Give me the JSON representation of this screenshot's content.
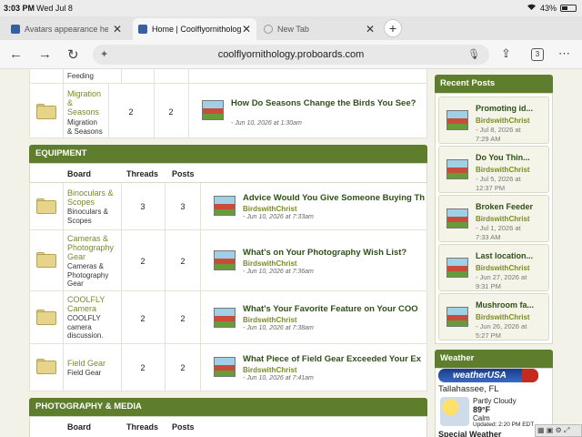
{
  "status": {
    "time": "3:03 PM",
    "date": "Wed Jul 8",
    "battery": "43%",
    "battery_level": 0.43
  },
  "tabs": [
    {
      "title": "Avatars appearance help",
      "active": false
    },
    {
      "title": "Home | Coolflyornithology",
      "active": true
    },
    {
      "title": "New Tab",
      "active": false
    }
  ],
  "address": {
    "url": "coolflyornithology.proboards.com",
    "tab_count": "3"
  },
  "top_partial": {
    "desc_tail": "Feeding",
    "board": {
      "name": [
        "Migration",
        "&",
        "Seasons"
      ],
      "desc": [
        "Migration",
        "& Seasons"
      ],
      "threads": "2",
      "posts": "2",
      "last_post": {
        "title": "How Do Seasons Change the Birds You See?",
        "date": "- Jun 10, 2026 at 1:30am"
      }
    }
  },
  "equipment": {
    "title": "EQUIPMENT",
    "headers": {
      "board": "Board",
      "threads": "Threads",
      "posts": "Posts"
    },
    "boards": [
      {
        "name": [
          "Binoculars &",
          "Scopes"
        ],
        "desc": [
          "Binoculars &",
          "Scopes"
        ],
        "threads": "3",
        "posts": "3",
        "last_post": {
          "title": "Advice Would You Give Someone Buying Th",
          "author": "BirdswithChrist",
          "date": "- Jun 10, 2026 at 7:33am"
        }
      },
      {
        "name": [
          "Cameras &",
          "Photography",
          "Gear"
        ],
        "desc": [
          "Cameras &",
          "Photography",
          "Gear"
        ],
        "threads": "2",
        "posts": "2",
        "last_post": {
          "title": "What's on Your Photography Wish List?",
          "author": "BirdswithChrist",
          "date": "- Jun 10, 2026 at 7:36am"
        }
      },
      {
        "name": [
          "COOLFLY",
          "Camera"
        ],
        "desc": [
          "COOLFLY",
          "camera",
          "discussion."
        ],
        "threads": "2",
        "posts": "2",
        "last_post": {
          "title": "What's Your Favorite Feature on Your COO",
          "author": "BirdswithChrist",
          "date": "- Jun 10, 2026 at 7:38am"
        }
      },
      {
        "name": [
          "Field Gear"
        ],
        "desc": [
          "Field Gear"
        ],
        "threads": "2",
        "posts": "2",
        "last_post": {
          "title": "What Piece of Field Gear Exceeded Your Ex",
          "author": "BirdswithChrist",
          "date": "- Jun 10, 2026 at 7:41am"
        }
      }
    ]
  },
  "photo_media": {
    "title": "PHOTOGRAPHY & MEDIA",
    "headers": {
      "board": "Board",
      "threads": "Threads",
      "posts": "Posts"
    }
  },
  "sidebar": {
    "recent_title": "Recent Posts",
    "recent": [
      {
        "title": "Promoting id...",
        "author": "BirdswithChrist",
        "date": [
          "- Jul 8, 2026 at",
          "7:29 AM"
        ]
      },
      {
        "title": "Do You Thin...",
        "author": "BirdswithChrist",
        "date": [
          "- Jul 5, 2026 at",
          "12:37 PM"
        ]
      },
      {
        "title": "Broken Feeder",
        "author": "BirdswithChrist",
        "date": [
          "- Jul 1, 2026 at",
          "7:33 AM"
        ]
      },
      {
        "title": "Last location...",
        "author": "BirdswithChrist",
        "date": [
          "- Jun 27, 2026 at",
          "9:31 PM"
        ]
      },
      {
        "title": "Mushroom fa...",
        "author": "BirdswithChrist",
        "date": [
          "- Jun 26, 2026 at",
          "5:27 PM"
        ]
      }
    ],
    "weather_title": "Weather",
    "weather": {
      "brand": "weatherUSA",
      "city": "Tallahassee, FL",
      "condition": "Partly Cloudy",
      "temp": "89°F",
      "wind": "Calm",
      "updated": "Updated: 2:20 PM EDT",
      "next_title": "Special Weather"
    }
  }
}
